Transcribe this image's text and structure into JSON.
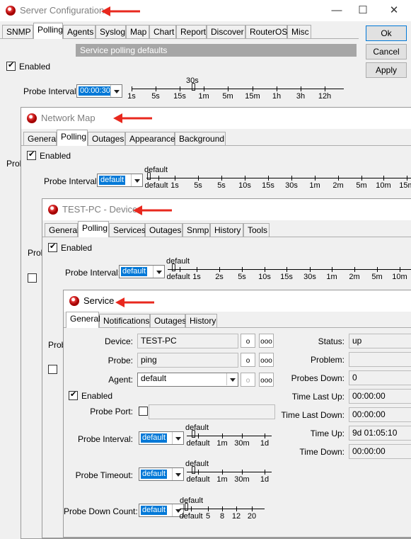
{
  "server_config": {
    "title": "Server Configuration",
    "tabs": [
      "SNMP",
      "Polling",
      "Agents",
      "Syslog",
      "Map",
      "Chart",
      "Report",
      "Discover",
      "RouterOS",
      "Misc"
    ],
    "buttons": {
      "ok": "Ok",
      "cancel": "Cancel",
      "apply": "Apply"
    },
    "section": "Service polling defaults",
    "enabled_label": "Enabled",
    "probe_interval_label": "Probe Interval:",
    "probe_interval_value": "00:00:30",
    "slider_current": "30s",
    "slider_ticks": [
      "1s",
      "5s",
      "15s",
      "1m",
      "5m",
      "15m",
      "1h",
      "3h",
      "12h"
    ],
    "hidden_label": "Prob"
  },
  "network_map": {
    "title": "Network Map",
    "tabs": [
      "General",
      "Polling",
      "Outages",
      "Appearance",
      "Background"
    ],
    "enabled_label": "Enabled",
    "probe_interval_label": "Probe Interval:",
    "probe_interval_value": "default",
    "slider_current": "default",
    "slider_ticks": [
      "default",
      "1s",
      "5s",
      "5s",
      "10s",
      "15s",
      "30s",
      "1m",
      "2m",
      "5m",
      "10m",
      "15m"
    ],
    "hidden_label": "Prob"
  },
  "device": {
    "title": "TEST-PC - Device",
    "tabs": [
      "General",
      "Polling",
      "Services",
      "Outages",
      "Snmp",
      "History",
      "Tools"
    ],
    "enabled_label": "Enabled",
    "probe_interval_label": "Probe Interval:",
    "probe_interval_value": "default",
    "slider_current": "default",
    "slider_ticks": [
      "default",
      "1s",
      "2s",
      "5s",
      "10s",
      "15s",
      "30s",
      "1m",
      "2m",
      "5m",
      "10m"
    ],
    "hidden_label": "Prob"
  },
  "service": {
    "title": "Service",
    "tabs": [
      "General",
      "Notifications",
      "Outages",
      "History"
    ],
    "device_label": "Device:",
    "device_value": "TEST-PC",
    "probe_label": "Probe:",
    "probe_value": "ping",
    "agent_label": "Agent:",
    "agent_value": "default",
    "small_button": "o",
    "more_button": "ooo",
    "enabled_label": "Enabled",
    "probe_port_label": "Probe Port:",
    "probe_interval_label": "Probe Interval:",
    "probe_timeout_label": "Probe Timeout:",
    "probe_down_count_label": "Probe Down Count:",
    "default_value": "default",
    "interval_ticks": [
      "default",
      "1m",
      "30m",
      "1d"
    ],
    "timeout_ticks": [
      "default",
      "1d",
      "1m",
      "30m",
      "1d"
    ],
    "down_count_ticks": [
      "default",
      "5",
      "8",
      "12",
      "20"
    ],
    "status": [
      {
        "label": "Status:",
        "value": "up"
      },
      {
        "label": "Problem:",
        "value": ""
      },
      {
        "label": "Probes Down:",
        "value": "0"
      },
      {
        "label": "Time Last Up:",
        "value": "00:00:00"
      },
      {
        "label": "Time Last Down:",
        "value": "00:00:00"
      },
      {
        "label": "Time Up:",
        "value": "9d 01:05:10"
      },
      {
        "label": "Time Down:",
        "value": "00:00:00"
      }
    ]
  },
  "colors": {
    "arrow": "#e8281e",
    "selection": "#0078d7",
    "section": "#a6a6a6"
  },
  "icons": {
    "app": "mikrotik-dude-icon",
    "minimize": "minimize-icon",
    "maximize": "maximize-icon",
    "close": "close-icon"
  }
}
